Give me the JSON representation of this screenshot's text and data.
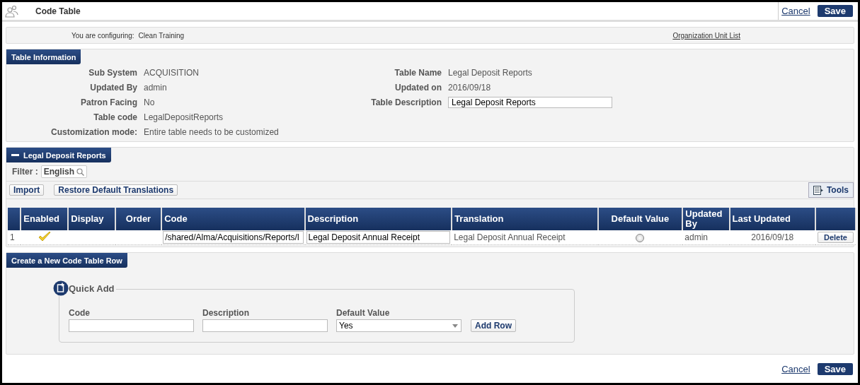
{
  "header": {
    "title": "Code Table",
    "cancel": "Cancel",
    "save": "Save"
  },
  "config": {
    "label": "You are configuring:",
    "value": "Clean Training",
    "link": "Organization Unit List"
  },
  "table_info": {
    "title": "Table Information",
    "left": [
      {
        "label": "Sub System",
        "value": "ACQUISITION"
      },
      {
        "label": "Updated By",
        "value": "admin"
      },
      {
        "label": "Patron Facing",
        "value": "No"
      },
      {
        "label": "Table code",
        "value": "LegalDepositReports"
      },
      {
        "label": "Customization mode:",
        "value": "Entire table needs to be customized"
      }
    ],
    "right": [
      {
        "label": "Table Name",
        "value": "Legal Deposit Reports",
        "kind": "text"
      },
      {
        "label": "Updated on",
        "value": "2016/09/18",
        "kind": "text"
      },
      {
        "label": "Table Description",
        "value": "Legal Deposit Reports",
        "kind": "input"
      }
    ]
  },
  "codes": {
    "title": "Legal Deposit Reports",
    "expanded": true,
    "filter_label": "Filter :",
    "filter_value": "English",
    "buttons": [
      "Import",
      "Restore Default Translations"
    ],
    "tools": "Tools",
    "columns": [
      "Enabled",
      "Display",
      "Order",
      "Code",
      "Description",
      "Translation",
      "Default Value",
      "Updated By",
      "Last Updated"
    ],
    "rows": [
      {
        "number": "1",
        "enabled": true,
        "code": "/shared/Alma/Acquisitions/Reports/l",
        "description": "Legal Deposit Annual Receipt",
        "translation": "Legal Deposit Annual Receipt",
        "default_value": false,
        "updated_by": "admin",
        "last_updated": "2016/09/18",
        "action": "Delete"
      }
    ]
  },
  "create": {
    "title": "Create a New Code Table Row",
    "legend": "Quick Add",
    "fields": [
      {
        "label": "Code",
        "kind": "input"
      },
      {
        "label": "Description",
        "kind": "input"
      },
      {
        "label": "Default Value",
        "kind": "select",
        "value": "Yes"
      }
    ],
    "add": "Add Row"
  },
  "footer": {
    "cancel": "Cancel",
    "save": "Save"
  }
}
